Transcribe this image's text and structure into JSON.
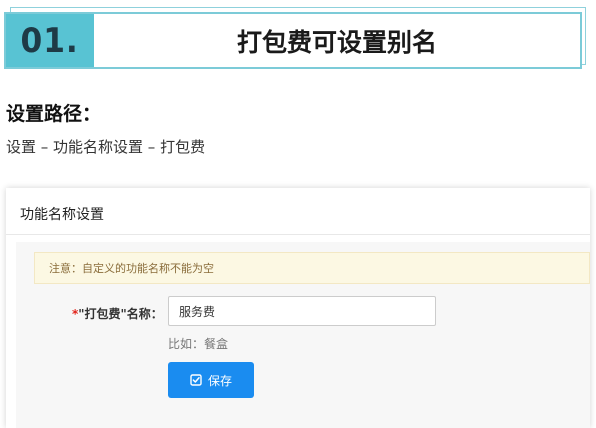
{
  "banner": {
    "number": "01.",
    "title": "打包费可设置别名"
  },
  "path": {
    "heading": "设置路径：",
    "text": "设置 – 功能名称设置 – 打包费"
  },
  "panel": {
    "title": "功能名称设置",
    "notice": "注意：自定义的功能名称不能为空",
    "field": {
      "required_mark": "*",
      "label": "\"打包费\"名称：",
      "value": "服务费",
      "hint": "比如：餐盒"
    },
    "save_button": {
      "icon": "check-square-icon",
      "label": "保存"
    }
  },
  "colors": {
    "banner_accent": "#58c3d3",
    "notice_bg": "#fcf8e3",
    "notice_text": "#8a6d3b",
    "primary_button": "#1a8cf0",
    "required": "#e2231a"
  }
}
